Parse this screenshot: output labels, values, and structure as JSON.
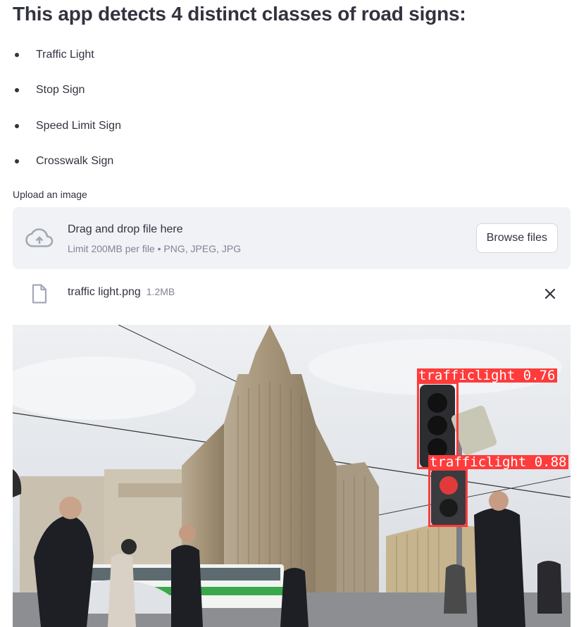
{
  "heading": "This app detects 4 distinct classes of road signs:",
  "classes": [
    "Traffic Light",
    "Stop Sign",
    "Speed Limit Sign",
    "Crosswalk Sign"
  ],
  "uploader": {
    "label": "Upload an image",
    "drag_text": "Drag and drop file here",
    "limit_text": "Limit 200MB per file • PNG, JPEG, JPG",
    "browse_label": "Browse files",
    "upload_icon": "cloud-upload-icon"
  },
  "uploaded_file": {
    "name": "traffic light.png",
    "size": "1.2MB",
    "file_icon": "file-icon",
    "remove_icon": "close-icon"
  },
  "detections": [
    {
      "label": "trafficlight",
      "confidence": "0.76"
    },
    {
      "label": "trafficlight",
      "confidence": "0.88"
    }
  ],
  "colors": {
    "text": "#31333f",
    "muted": "#808495",
    "dropzone_bg": "#f0f2f6",
    "detection_box": "#ff3b3b"
  }
}
